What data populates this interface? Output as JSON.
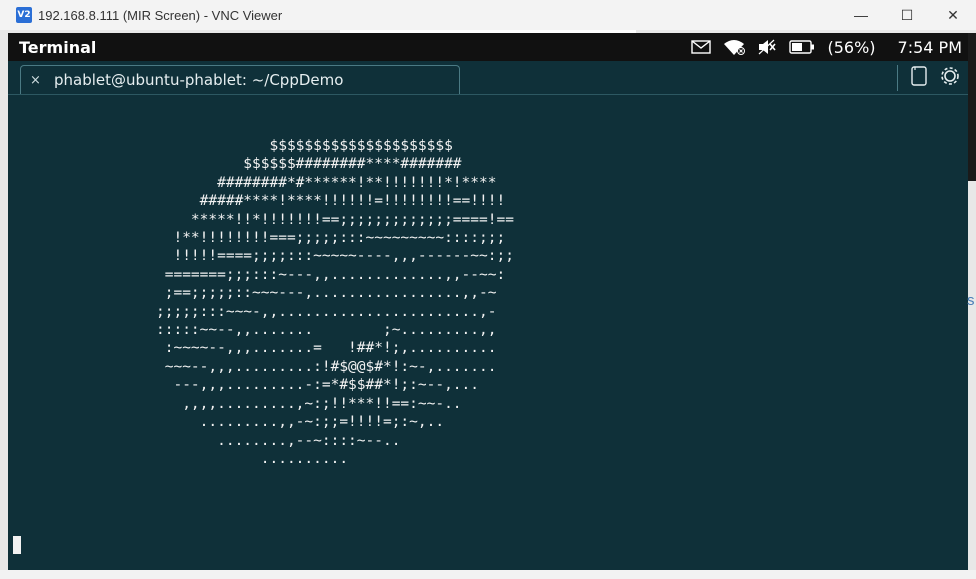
{
  "window": {
    "logo_text": "V2",
    "title": "192.168.8.111 (MIR Screen) - VNC Viewer",
    "minimize_glyph": "—",
    "maximize_glyph": "☐",
    "close_glyph": "✕"
  },
  "status_bar": {
    "app_name": "Terminal",
    "indicators": [
      "mail-icon",
      "wifi-icon",
      "volume-muted-icon",
      "battery-icon"
    ],
    "battery_percent": "(56%)",
    "time": "7:54 PM"
  },
  "tab": {
    "close_glyph": "×",
    "title": "phablet@ubuntu-phablet: ~/CppDemo"
  },
  "tab_actions": [
    "new-tab-icon",
    "settings-icon"
  ],
  "terminal": {
    "lines": [
      "             $$$$$$$$$$$$$$$$$$$$$",
      "          $$$$$$########****#######",
      "       ########*#******!**!!!!!!!*!****",
      "     #####****!****!!!!!!=!!!!!!!!==!!!!",
      "    *****!!*!!!!!!!==;;;;;;;;;;;;;====!==",
      "  !**!!!!!!!!===;;;;;:::~~~~~~~~~::::;;;",
      "  !!!!!====;;;;:::~~~~~----,,,------~~:;;",
      " =======;;;:::~---,,.............,,--~~:",
      " ;==;;;;;::~~~---,.................,,-~",
      ";;;;;:::~~~-,,.......................,-",
      ":::::~~--,,.......        ;~.........,,",
      " :~~~~--,,,.......=   !##*!;,..........",
      " ~~~--,,,.........:!#$@@$#*!:~-,.......",
      "  ---,,,.........-:=*#$$##*!;:~--,...",
      "   ,,,,.........,~:;!!***!!==:~~-..",
      "     .........,,-~:;;=!!!!=;:~,..",
      "       ........,--~::::~--..",
      "            .........."
    ]
  },
  "side": {
    "edge_letter": "s"
  }
}
